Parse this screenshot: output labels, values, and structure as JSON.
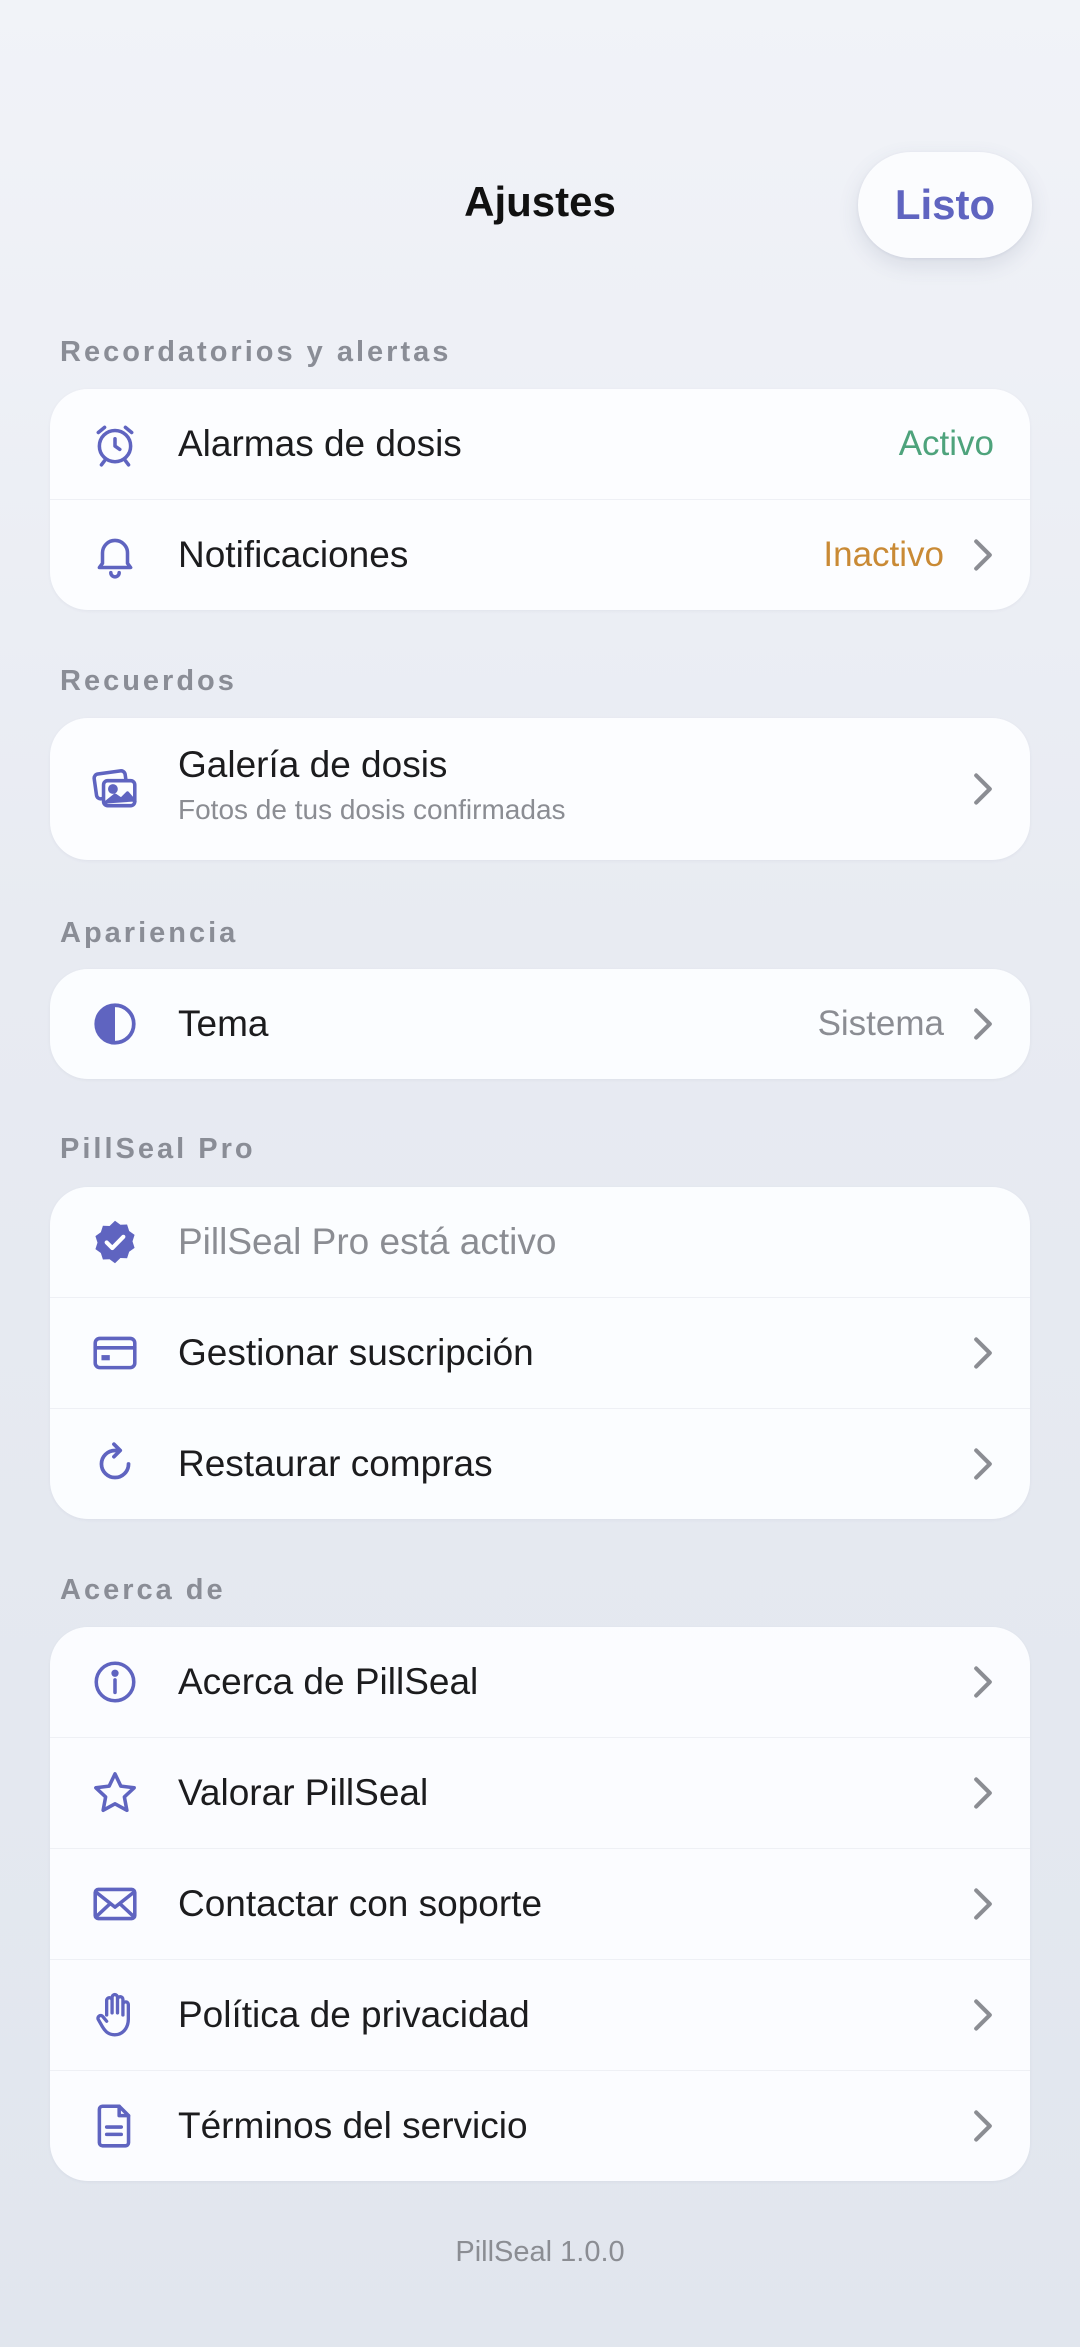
{
  "header": {
    "title": "Ajustes",
    "done_label": "Listo"
  },
  "sections": {
    "reminders": {
      "label": "Recordatorios y alertas",
      "alarms": {
        "label": "Alarmas de dosis",
        "value": "Activo"
      },
      "notifications": {
        "label": "Notificaciones",
        "value": "Inactivo"
      }
    },
    "memories": {
      "label": "Recuerdos",
      "gallery": {
        "label": "Galería de dosis",
        "subtitle": "Fotos de tus dosis confirmadas"
      }
    },
    "appearance": {
      "label": "Apariencia",
      "theme": {
        "label": "Tema",
        "value": "Sistema"
      }
    },
    "pro": {
      "label": "PillSeal Pro",
      "status": {
        "label": "PillSeal Pro está activo"
      },
      "manage": {
        "label": "Gestionar suscripción"
      },
      "restore": {
        "label": "Restaurar compras"
      }
    },
    "about": {
      "label": "Acerca de",
      "about_app": {
        "label": "Acerca de PillSeal"
      },
      "rate": {
        "label": "Valorar PillSeal"
      },
      "support": {
        "label": "Contactar con soporte"
      },
      "privacy": {
        "label": "Política de privacidad"
      },
      "terms": {
        "label": "Términos del servicio"
      }
    }
  },
  "footer": {
    "version": "PillSeal 1.0.0"
  },
  "colors": {
    "accent": "#5f64c0",
    "active": "#4ea37c",
    "inactive": "#c98a35",
    "secondary_text": "#8b8d93"
  },
  "icons": {
    "alarms": "alarm-clock-icon",
    "notifications": "bell-icon",
    "gallery": "photos-icon",
    "theme": "half-circle-icon",
    "pro_status": "verified-badge-icon",
    "manage": "credit-card-icon",
    "restore": "refresh-icon",
    "about_app": "info-icon",
    "rate": "star-icon",
    "support": "envelope-icon",
    "privacy": "hand-icon",
    "terms": "document-icon",
    "chevron": "chevron-right-icon"
  }
}
